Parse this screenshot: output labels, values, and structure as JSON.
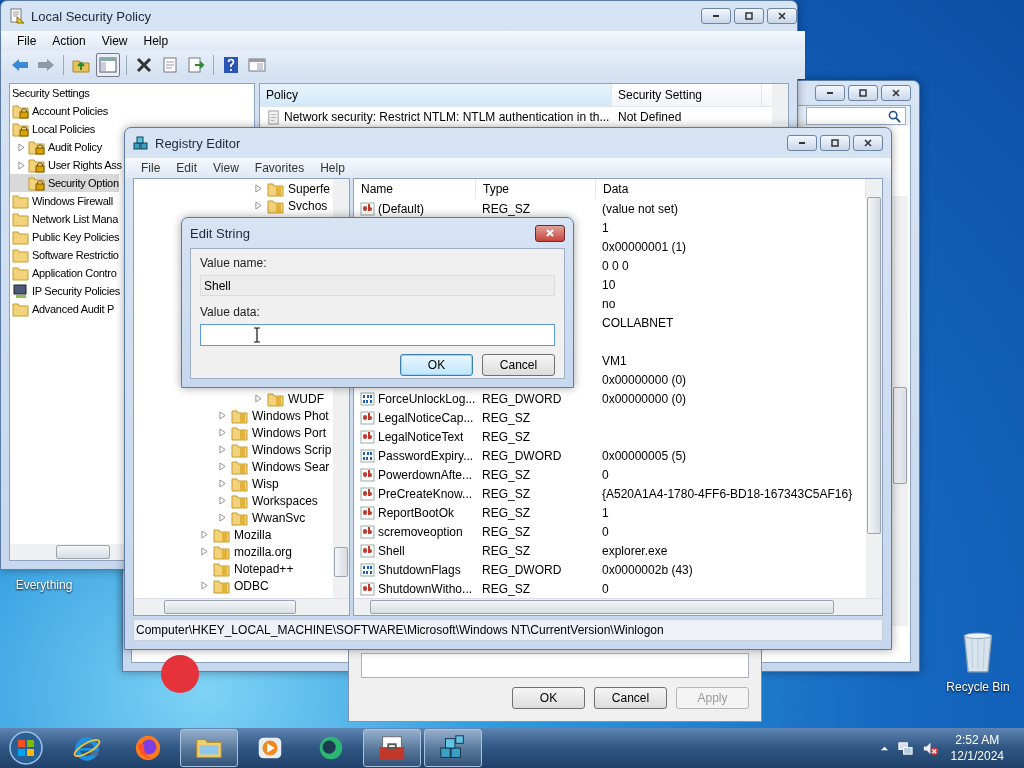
{
  "desktop_icons": [
    {
      "label": "Everything"
    },
    {
      "label": "Recycle Bin"
    }
  ],
  "local_security_policy": {
    "title": "Local Security Policy",
    "menu": [
      "File",
      "Action",
      "View",
      "Help"
    ],
    "tree": [
      {
        "label": "Security Settings",
        "selected": false,
        "children": [
          {
            "label": "Account Policies",
            "kind": "locked",
            "selected": false
          },
          {
            "label": "Local Policies",
            "kind": "locked",
            "selected": false,
            "children": [
              {
                "label": "Audit Policy",
                "kind": "locked",
                "expanded": false,
                "selected": false
              },
              {
                "label": "User Rights Ass",
                "kind": "locked",
                "expanded": false,
                "selected": false
              },
              {
                "label": "Security Option",
                "kind": "locked",
                "selected": true
              }
            ]
          },
          {
            "label": "Windows Firewall",
            "kind": "folder",
            "selected": false
          },
          {
            "label": "Network List Mana",
            "kind": "folder",
            "selected": false
          },
          {
            "label": "Public Key Policies",
            "kind": "folder",
            "selected": false
          },
          {
            "label": "Software Restrictio",
            "kind": "folder",
            "selected": false
          },
          {
            "label": "Application Contro",
            "kind": "folder",
            "selected": false
          },
          {
            "label": "IP Security Policies",
            "kind": "computer",
            "selected": false
          },
          {
            "label": "Advanced Audit P",
            "kind": "folder",
            "selected": false
          }
        ]
      }
    ],
    "columns": [
      "Policy",
      "Security Setting"
    ],
    "rows": [
      {
        "policy": "Network security: Restrict NTLM: NTLM authentication in th...",
        "setting": "Not Defined"
      }
    ]
  },
  "properties_dialog": {
    "buttons": [
      {
        "label": "OK",
        "disabled": false
      },
      {
        "label": "Cancel",
        "disabled": false
      },
      {
        "label": "Apply",
        "disabled": true
      }
    ]
  },
  "registry_editor": {
    "title": "Registry Editor",
    "menu": [
      "File",
      "Edit",
      "View",
      "Favorites",
      "Help"
    ],
    "tree": [
      {
        "children": [
          {
            "children": [
              {
                "children": [
                  {
                    "label": "Superfe",
                    "expanded": false
                  },
                  {
                    "label": "Svchos",
                    "expanded": false
                  },
                  {
                    "label": "WUDF",
                    "expanded": false
                  }
                ]
              }
            ]
          },
          {
            "label": "Windows Phot",
            "expanded": false
          },
          {
            "label": "Windows Port",
            "expanded": false
          },
          {
            "label": "Windows Scrip",
            "expanded": false
          },
          {
            "label": "Windows Sear",
            "expanded": false
          },
          {
            "label": "Wisp",
            "expanded": false
          },
          {
            "label": "Workspaces",
            "expanded": false
          },
          {
            "label": "WwanSvc",
            "expanded": false
          }
        ]
      },
      {
        "label": "Mozilla",
        "expanded": false
      },
      {
        "label": "mozilla.org",
        "expanded": false
      },
      {
        "label": "Notepad++"
      },
      {
        "label": "ODBC",
        "expanded": false
      }
    ],
    "columns": [
      "Name",
      "Type",
      "Data"
    ],
    "rows": [
      {
        "kind": "sz",
        "name": "(Default)",
        "type": "REG_SZ",
        "data": "(value not set)"
      },
      {
        "data": "1"
      },
      {
        "data": "0x00000001 (1)"
      },
      {
        "data": "0 0 0"
      },
      {
        "data": "10"
      },
      {
        "data": "no"
      },
      {
        "data": "COLLABNET"
      },
      {},
      {
        "data": "VM1"
      },
      {
        "data": "0x00000000 (0)"
      },
      {
        "kind": "dword",
        "name": "ForceUnlockLog...",
        "type": "REG_DWORD",
        "data": "0x00000000 (0)"
      },
      {
        "kind": "sz",
        "name": "LegalNoticeCap...",
        "type": "REG_SZ"
      },
      {
        "kind": "sz",
        "name": "LegalNoticeText",
        "type": "REG_SZ"
      },
      {
        "kind": "dword",
        "name": "PasswordExpiry...",
        "type": "REG_DWORD",
        "data": "0x00000005 (5)"
      },
      {
        "kind": "sz",
        "name": "PowerdownAfte...",
        "type": "REG_SZ",
        "data": "0"
      },
      {
        "kind": "sz",
        "name": "PreCreateKnow...",
        "type": "REG_SZ",
        "data": "{A520A1A4-1780-4FF6-BD18-167343C5AF16}"
      },
      {
        "kind": "sz",
        "name": "ReportBootOk",
        "type": "REG_SZ",
        "data": "1"
      },
      {
        "kind": "sz",
        "name": "scremoveoption",
        "type": "REG_SZ",
        "data": "0"
      },
      {
        "kind": "sz",
        "name": "Shell",
        "type": "REG_SZ",
        "data": "explorer.exe"
      },
      {
        "kind": "dword",
        "name": "ShutdownFlags",
        "type": "REG_DWORD",
        "data": "0x0000002b (43)"
      },
      {
        "kind": "sz",
        "name": "ShutdownWitho...",
        "type": "REG_SZ",
        "data": "0"
      }
    ],
    "status": "Computer\\HKEY_LOCAL_MACHINE\\SOFTWARE\\Microsoft\\Windows NT\\CurrentVersion\\Winlogon"
  },
  "edit_string": {
    "title": "Edit String",
    "value_name_label": "Value name:",
    "value_name": "Shell",
    "value_data_label": "Value data:",
    "buttons": [
      "OK",
      "Cancel"
    ]
  },
  "taskbar": {
    "items": [
      {
        "open": false
      },
      {
        "open": false
      },
      {
        "open": true
      },
      {
        "open": false
      },
      {
        "open": false
      },
      {
        "open": true
      },
      {
        "open": true
      }
    ],
    "clock": {
      "time": "2:52 AM",
      "date": "12/1/2024"
    }
  }
}
